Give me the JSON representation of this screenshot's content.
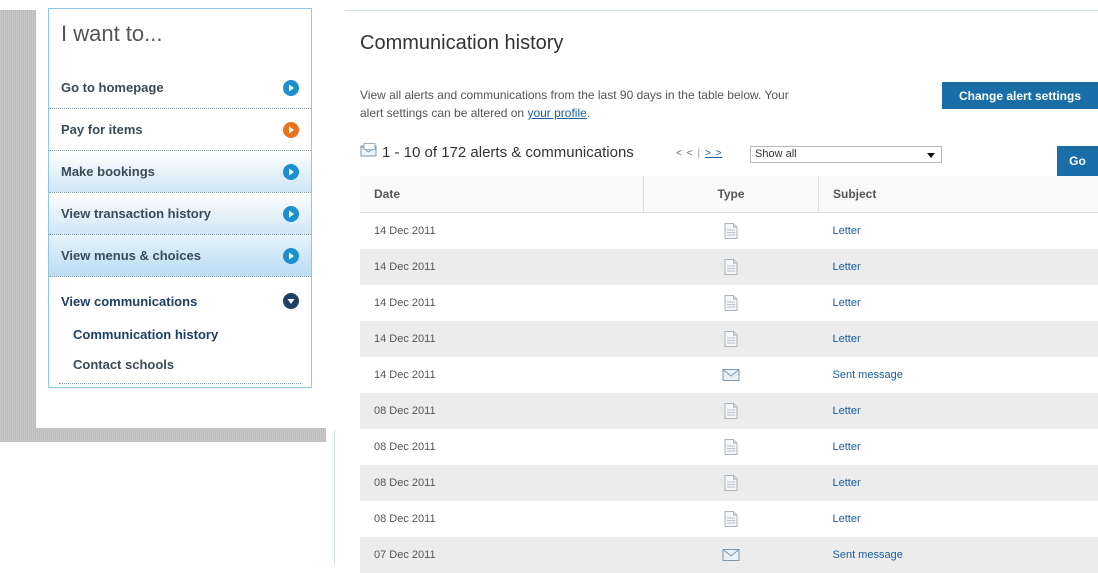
{
  "sidebar": {
    "title": "I want to...",
    "items": [
      {
        "label": "Go to homepage",
        "color": "#1b8fd0"
      },
      {
        "label": "Pay for items",
        "color": "#e8731e"
      },
      {
        "label": "Make bookings",
        "color": "#1b8fd0"
      },
      {
        "label": "View transaction history",
        "color": "#1b8fd0"
      },
      {
        "label": "View menus & choices",
        "color": "#1b8fd0"
      },
      {
        "label": "View communications",
        "color": "#1e3f66"
      }
    ],
    "subitems": [
      {
        "label": "Communication history"
      },
      {
        "label": "Contact schools"
      }
    ]
  },
  "main": {
    "title": "Communication history",
    "intro_text": "View all alerts and communications from the last 90 days in the table below. Your alert settings can be altered on ",
    "intro_link": "your profile",
    "intro_end": ".",
    "change_button": "Change alert settings",
    "count_text": "1 - 10 of 172 alerts & communications",
    "pager_prev": "< <",
    "pager_next": "> >",
    "filter_selected": "Show all",
    "go_button": "Go",
    "columns": [
      "Date",
      "Type",
      "Subject"
    ],
    "rows": [
      {
        "date": "14 Dec 2011",
        "type": "document-icon",
        "subject": "Letter"
      },
      {
        "date": "14 Dec 2011",
        "type": "document-icon",
        "subject": "Letter"
      },
      {
        "date": "14 Dec 2011",
        "type": "document-icon",
        "subject": "Letter"
      },
      {
        "date": "14 Dec 2011",
        "type": "document-icon",
        "subject": "Letter"
      },
      {
        "date": "14 Dec 2011",
        "type": "envelope-icon",
        "subject": "Sent message"
      },
      {
        "date": "08 Dec 2011",
        "type": "document-icon",
        "subject": "Letter"
      },
      {
        "date": "08 Dec 2011",
        "type": "document-icon",
        "subject": "Letter"
      },
      {
        "date": "08 Dec 2011",
        "type": "document-icon",
        "subject": "Letter"
      },
      {
        "date": "08 Dec 2011",
        "type": "document-icon",
        "subject": "Letter"
      },
      {
        "date": "07 Dec 2011",
        "type": "envelope-icon",
        "subject": "Sent message"
      }
    ]
  }
}
